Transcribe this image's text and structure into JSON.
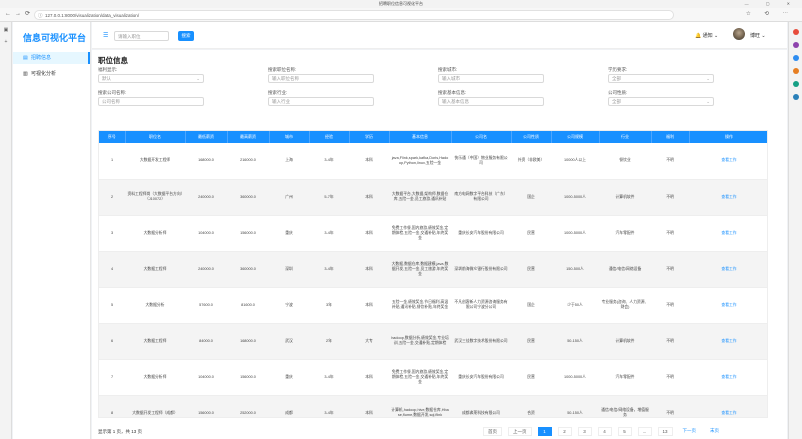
{
  "window": {
    "title": "招聘职位信息可视化平台"
  },
  "browser": {
    "url": "127.0.0.1:8000/visualization/data_visualization/"
  },
  "sidebar": {
    "title": "信息可视化平台",
    "items": [
      {
        "label": "招聘信息",
        "icon": "list-icon",
        "active": true
      },
      {
        "label": "可视化分析",
        "icon": "chart-icon",
        "active": false
      }
    ]
  },
  "header": {
    "search_placeholder": "请输入职位",
    "search_label": "搜索",
    "notify_label": "通知",
    "username": "博旺"
  },
  "content": {
    "title": "职位信息",
    "filters": [
      {
        "label": "福利显示:",
        "value": "默认",
        "kind": "select"
      },
      {
        "label": "搜索职位名称:",
        "value": "输入职位名称",
        "kind": "input"
      },
      {
        "label": "搜索城市:",
        "value": "输入城市",
        "kind": "input"
      },
      {
        "label": "学历要求:",
        "value": "全部",
        "kind": "select"
      },
      {
        "label": "搜索公司名称:",
        "value": "公司名称",
        "kind": "input"
      },
      {
        "label": "搜索行业:",
        "value": "输入行业",
        "kind": "input"
      },
      {
        "label": "搜索基本信息:",
        "value": "输入基本信息",
        "kind": "input"
      },
      {
        "label": "公司性质:",
        "value": "全部",
        "kind": "select"
      }
    ],
    "table": {
      "columns": [
        "序号",
        "职位名",
        "最低薪资",
        "最高薪资",
        "城市",
        "经验",
        "学历",
        "基本信息",
        "公司名",
        "公司性质",
        "公司规模",
        "行业",
        "福利",
        "操作"
      ],
      "rows": [
        [
          "1",
          "大数据开发工程师",
          "168000.0",
          "216000.0",
          "上海",
          "3-4年",
          "本科",
          "java,Flink,spark,kafka,Doris,Hadoop,Python,linux,五险一金",
          "快乐通（中国）物业服务有限公司",
          "外资（非欧美）",
          "10000人以上",
          "餐饮业",
          "不明",
          "查看工作"
        ],
        [
          "2",
          "资料工程师岗（大数据平台方向）（J10072）",
          "240000.0",
          "360000.0",
          "广州",
          "5-7年",
          "本科",
          "大数据平台,大数据,架构师,数据仓库,五险一金,员工旅游,通讯补贴",
          "南方电网数字平台科技（广东）有限公司",
          "国企",
          "1000-5000人",
          "计算机软件",
          "不明",
          "查看工作"
        ],
        [
          "3",
          "大数据分析师",
          "104000.0",
          "156000.0",
          "重庆",
          "3-4年",
          "本科",
          "免费工作餐,国内旅游,绩效奖金,定期体检,五险一金,交通补贴,年终奖金",
          "重庆长安汽车股份有限公司",
          "民营",
          "1000-5000人",
          "汽车零配件",
          "不明",
          "查看工作"
        ],
        [
          "4",
          "大数据工程师",
          "240000.0",
          "360000.0",
          "深圳",
          "3-4年",
          "本科",
          "大数据,数据仓库,数据建模,java,数据开发,五险一金,员工旅游,年终奖金",
          "深圳前海微众银行股份有限公司",
          "民营",
          "150-500人",
          "通信/电信/网络设备",
          "不明",
          "查看工作"
        ],
        [
          "5",
          "大数据分析",
          "57600.0",
          "81600.0",
          "宁波",
          "3年",
          "本科",
          "五险一金,绩效奖金,节日福利,高温补贴,通讯补贴,餐饮补贴,年终奖金",
          "不凡创客新人力资源咨询服务有限公司宁波分公司",
          "国企",
          "少于50人",
          "专业服务(咨询、人力资源、财会)",
          "不明",
          "查看工作"
        ],
        [
          "6",
          "大数据工程师",
          "84000.0",
          "168000.0",
          "武汉",
          "2年",
          "大专",
          "hadoop,数据分析,绩效奖金,专业培训,五险一金,交通补贴,定期体检",
          "武汉三佳数字技术股份有限公司",
          "民营",
          "50-150人",
          "计算机软件",
          "不明",
          "查看工作"
        ],
        [
          "7",
          "大数据分析师",
          "104000.0",
          "156000.0",
          "重庆",
          "3-4年",
          "本科",
          "免费工作餐,国内旅游,绩效奖金,定期体检,五险一金,交通补贴,年终奖金",
          "重庆长安汽车股份有限公司",
          "民营",
          "1000-5000人",
          "汽车零配件",
          "不明",
          "查看工作"
        ],
        [
          "8",
          "大数据开发工程师（成都）",
          "156000.0",
          "252000.0",
          "成都",
          "3-4年",
          "本科",
          "计算机,hadoop,hive,数据仓库,Hbase,flume,数据开发,sql,flink",
          "成都弗莱科技有限公司",
          "合资",
          "50-150人",
          "通信/电信/网络设备，增值服务",
          "不明",
          "查看工作"
        ]
      ]
    },
    "footer": {
      "total_text": "显示第 1 页，共 13 页",
      "pages": [
        "首页",
        "上一页",
        "1",
        "2",
        "3",
        "4",
        "5",
        "...",
        "13",
        "下一页",
        "末页"
      ],
      "current_page": "1"
    }
  }
}
